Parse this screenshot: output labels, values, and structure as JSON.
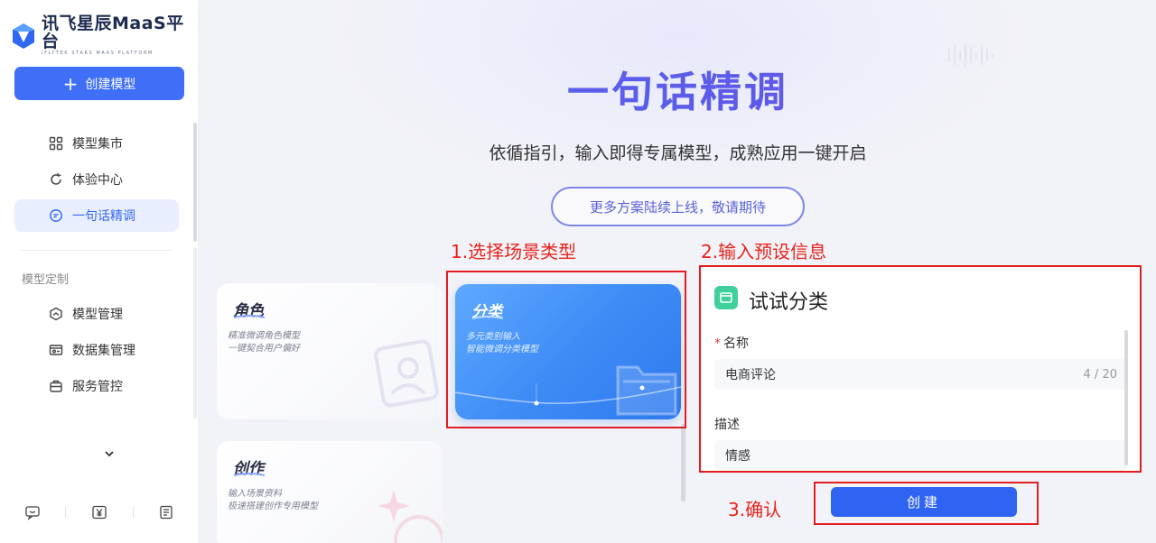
{
  "sidebar": {
    "logo": {
      "title": "讯飞星辰MaaS平台",
      "subtitle": "IFLYTEK STARS MAAS PLATFORM"
    },
    "create_button": "创建模型",
    "nav": [
      {
        "label": "模型集市",
        "icon": "grid-icon"
      },
      {
        "label": "体验中心",
        "icon": "refresh-icon"
      },
      {
        "label": "一句话精调",
        "icon": "chat-icon",
        "active": true
      }
    ],
    "section_title": "模型定制",
    "section_nav": [
      {
        "label": "模型管理",
        "icon": "hexagon-icon"
      },
      {
        "label": "数据集管理",
        "icon": "dataset-icon"
      },
      {
        "label": "服务管控",
        "icon": "service-icon"
      }
    ],
    "bottom_icons": [
      "feedback-icon",
      "billing-icon",
      "docs-icon"
    ]
  },
  "hero": {
    "title": "一句话精调",
    "subtitle": "依循指引，输入即得专属模型，成熟应用一键开启",
    "pill": "更多方案陆续上线，敬请期待"
  },
  "annotations": {
    "step1": "1.选择场景类型",
    "step2": "2.输入预设信息",
    "step3": "3.确认"
  },
  "cards": [
    {
      "title": "角色",
      "desc1": "精准微调角色模型",
      "desc2": "一键契合用户偏好"
    },
    {
      "title": "分类",
      "desc1": "多元类别输入",
      "desc2": "智能微调分类模型",
      "selected": true
    },
    {
      "title": "创作",
      "desc1": "输入场景资料",
      "desc2": "极速搭建创作专用模型"
    }
  ],
  "form": {
    "title": "试试分类",
    "name_label": "名称",
    "name_value": "电商评论",
    "name_count": "4 / 20",
    "desc_label": "描述",
    "desc_value": "情感"
  },
  "submit_button": "创建",
  "colors": {
    "accent": "#3f6ff6",
    "annotation": "#e21e1e",
    "active_bg": "#e9efff"
  }
}
